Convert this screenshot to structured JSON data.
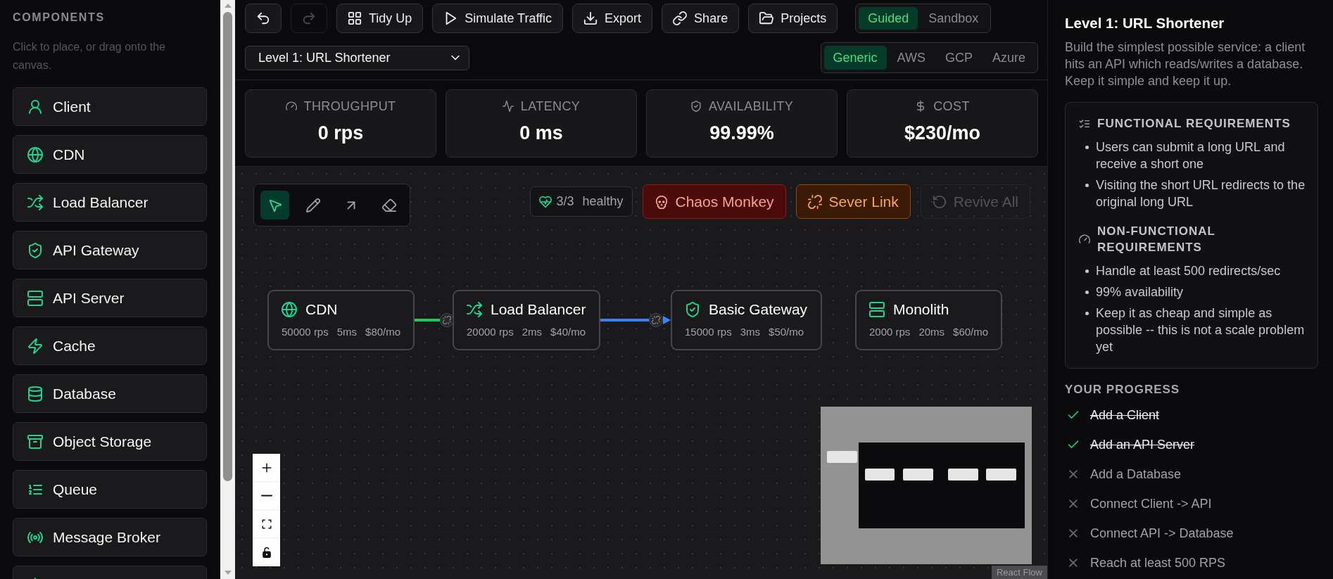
{
  "sidebar": {
    "heading": "COMPONENTS",
    "hint": "Click to place, or drag onto the canvas.",
    "items": [
      {
        "kind": "client",
        "label": "Client"
      },
      {
        "kind": "cdn",
        "label": "CDN"
      },
      {
        "kind": "load_balancer",
        "label": "Load Balancer"
      },
      {
        "kind": "api_gateway",
        "label": "API Gateway"
      },
      {
        "kind": "api_server",
        "label": "API Server"
      },
      {
        "kind": "cache",
        "label": "Cache"
      },
      {
        "kind": "database",
        "label": "Database"
      },
      {
        "kind": "object_storage",
        "label": "Object Storage"
      },
      {
        "kind": "queue",
        "label": "Queue"
      },
      {
        "kind": "message_broker",
        "label": "Message Broker"
      },
      {
        "kind": "worker"
      }
    ]
  },
  "toolbar": {
    "buttons": [
      {
        "kind": "undo",
        "disabled": false
      },
      {
        "kind": "redo",
        "disabled": true
      },
      {
        "kind": "tidy",
        "label": "Tidy Up",
        "disabled": false
      },
      {
        "kind": "simulate",
        "label": "Simulate Traffic",
        "disabled": false
      },
      {
        "kind": "export",
        "label": "Export",
        "disabled": false
      },
      {
        "kind": "share",
        "label": "Share",
        "disabled": false
      },
      {
        "kind": "projects",
        "label": "Projects",
        "disabled": false
      }
    ],
    "modes": [
      {
        "label": "Guided",
        "selected": true
      },
      {
        "label": "Sandbox",
        "selected": false
      }
    ],
    "level_select": {
      "value": "Level 1: URL Shortener"
    },
    "providers": [
      {
        "label": "Generic",
        "selected": true
      },
      {
        "label": "AWS",
        "selected": false
      },
      {
        "label": "GCP",
        "selected": false
      },
      {
        "label": "Azure",
        "selected": false
      }
    ]
  },
  "metrics": [
    {
      "kind": "throughput",
      "label": "THROUGHPUT",
      "value": "0 rps"
    },
    {
      "kind": "latency",
      "label": "LATENCY",
      "value": "0 ms"
    },
    {
      "kind": "availability",
      "label": "AVAILABILITY",
      "value": "99.99%"
    },
    {
      "kind": "cost",
      "label": "COST",
      "value": "$230/mo"
    }
  ],
  "canvas": {
    "tools": [
      {
        "kind": "select",
        "selected": true
      },
      {
        "kind": "pencil",
        "selected": false
      },
      {
        "kind": "arrow",
        "selected": false
      },
      {
        "kind": "eraser",
        "selected": false
      }
    ],
    "health": {
      "count": "3/3",
      "label": "healthy"
    },
    "actions": [
      {
        "kind": "chaos",
        "label": "Chaos Monkey",
        "disabled": false
      },
      {
        "kind": "sever",
        "label": "Sever Link",
        "disabled": false
      },
      {
        "kind": "revive",
        "label": "Revive All",
        "disabled": true
      }
    ],
    "nodes": [
      {
        "kind": "cdn",
        "title": "CDN",
        "throughput": "50000 rps",
        "latency": "5ms",
        "cost": "$80/mo",
        "link": {
          "color": "#22c55e",
          "arrow": false
        }
      },
      {
        "kind": "load_balancer",
        "title": "Load Balancer",
        "throughput": "20000 rps",
        "latency": "2ms",
        "cost": "$40/mo",
        "link": {
          "color": "#3b82f6",
          "arrow": true
        }
      },
      {
        "kind": "api_gateway",
        "title": "Basic Gateway",
        "throughput": "15000 rps",
        "latency": "3ms",
        "cost": "$50/mo"
      },
      {
        "kind": "api_server",
        "title": "Monolith",
        "throughput": "2000 rps",
        "latency": "20ms",
        "cost": "$60/mo"
      }
    ],
    "zoom_controls": [
      {
        "kind": "zoom_in"
      },
      {
        "kind": "zoom_out"
      },
      {
        "kind": "fit_view"
      },
      {
        "kind": "lock"
      }
    ],
    "attribution": "React Flow"
  },
  "level": {
    "title": "Level 1: URL Shortener",
    "description": "Build the simplest possible service: a client hits an API which reads/writes a database. Keep it simple and keep it up.",
    "requirements": [
      {
        "kind": "functional",
        "heading": "FUNCTIONAL REQUIREMENTS",
        "items": [
          "Users can submit a long URL and receive a short one",
          "Visiting the short URL redirects to the original long URL"
        ]
      },
      {
        "kind": "non_functional",
        "heading": "NON-FUNCTIONAL REQUIREMENTS",
        "items": [
          "Handle at least 500 redirects/sec",
          "99% availability",
          "Keep it as cheap and simple as possible -- this is not a scale problem yet"
        ]
      }
    ]
  },
  "progress": {
    "heading": "YOUR PROGRESS",
    "items": [
      {
        "label": "Add a Client",
        "done": true
      },
      {
        "label": "Add an API Server",
        "done": true
      },
      {
        "label": "Add a Database",
        "done": false
      },
      {
        "label": "Connect Client -> API",
        "done": false
      },
      {
        "label": "Connect API -> Database",
        "done": false
      },
      {
        "label": "Reach at least 500 RPS",
        "done": false
      }
    ]
  }
}
